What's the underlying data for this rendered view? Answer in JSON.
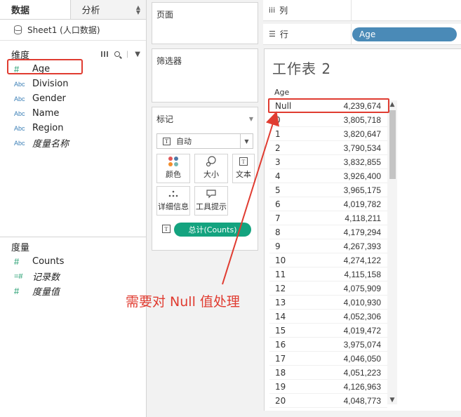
{
  "left_pane": {
    "tabs": [
      {
        "label": "数据",
        "active": true
      },
      {
        "label": "分析",
        "active": false
      }
    ],
    "data_source": "Sheet1 (人口数据)",
    "dimensions_title": "维度",
    "dimensions": [
      {
        "type_icon": "#",
        "label": "Age",
        "icon_name": "number-icon"
      },
      {
        "type_icon": "Abc",
        "label": "Division",
        "icon_name": "text-icon"
      },
      {
        "type_icon": "Abc",
        "label": "Gender",
        "icon_name": "text-icon"
      },
      {
        "type_icon": "Abc",
        "label": "Name",
        "icon_name": "text-icon"
      },
      {
        "type_icon": "Abc",
        "label": "Region",
        "icon_name": "text-icon"
      },
      {
        "type_icon": "Abc",
        "label": "度量名称",
        "icon_name": "text-icon"
      }
    ],
    "measures_title": "度量",
    "measures": [
      {
        "type_icon": "#",
        "label": "Counts"
      },
      {
        "type_icon": "=#",
        "label": "记录数"
      },
      {
        "type_icon": "#",
        "label": "度量值"
      }
    ]
  },
  "shelves": {
    "pages_title": "页面",
    "filters_title": "筛选器",
    "marks_title": "标记",
    "mark_type": "自动",
    "mark_type_icon": "T",
    "mark_buttons": [
      {
        "label": "颜色",
        "icon_name": "color-icon"
      },
      {
        "label": "大小",
        "icon_name": "size-icon"
      },
      {
        "label": "文本",
        "icon_name": "text-label-icon"
      },
      {
        "label": "详细信息",
        "icon_name": "detail-icon"
      },
      {
        "label": "工具提示",
        "icon_name": "tooltip-icon"
      }
    ],
    "text_icon": "T",
    "mark_pill": "总计(Counts)",
    "accent_color": "#14a37f"
  },
  "view": {
    "columns_label": "列",
    "rows_label": "行",
    "row_pill": "Age",
    "row_pill_color": "#4a8ab7",
    "sheet_title": "工作表 2",
    "column_header": "Age",
    "rows": [
      {
        "key": "Null",
        "value": "4,239,674"
      },
      {
        "key": "0",
        "value": "3,805,718"
      },
      {
        "key": "1",
        "value": "3,820,647"
      },
      {
        "key": "2",
        "value": "3,790,534"
      },
      {
        "key": "3",
        "value": "3,832,855"
      },
      {
        "key": "4",
        "value": "3,926,400"
      },
      {
        "key": "5",
        "value": "3,965,175"
      },
      {
        "key": "6",
        "value": "4,019,782"
      },
      {
        "key": "7",
        "value": "4,118,211"
      },
      {
        "key": "8",
        "value": "4,179,294"
      },
      {
        "key": "9",
        "value": "4,267,393"
      },
      {
        "key": "10",
        "value": "4,274,122"
      },
      {
        "key": "11",
        "value": "4,115,158"
      },
      {
        "key": "12",
        "value": "4,075,909"
      },
      {
        "key": "13",
        "value": "4,010,930"
      },
      {
        "key": "14",
        "value": "4,052,306"
      },
      {
        "key": "15",
        "value": "4,019,472"
      },
      {
        "key": "16",
        "value": "3,975,074"
      },
      {
        "key": "17",
        "value": "4,046,050"
      },
      {
        "key": "18",
        "value": "4,051,223"
      },
      {
        "key": "19",
        "value": "4,126,963"
      },
      {
        "key": "20",
        "value": "4,048,773"
      }
    ]
  },
  "annotation": {
    "text": "需要对 Null 值处理",
    "color": "#e03c31"
  }
}
